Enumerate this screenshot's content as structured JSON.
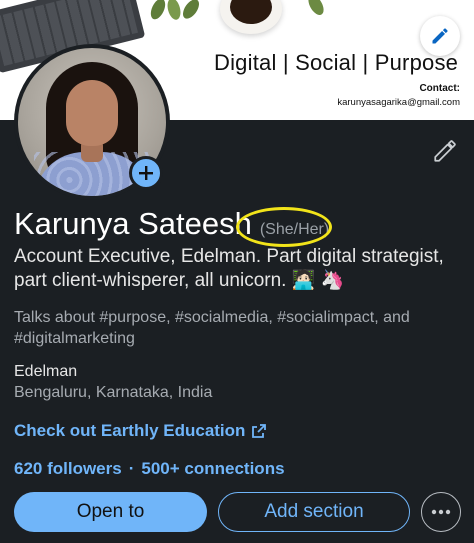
{
  "banner": {
    "tagline": "Digital | Social | Purpose",
    "contact_label": "Contact:",
    "contact_email": "karunyasagarika@gmail.com"
  },
  "profile": {
    "name": "Karunya Sateesh",
    "pronouns": "(She/Her)",
    "headline": "Account Executive, Edelman. Part digital strategist, part client-whisperer, all unicorn. 🧑🏻‍💻 🦄",
    "talks_about": "Talks about #purpose, #socialmedia, #socialimpact, and #digitalmarketing",
    "company": "Edelman",
    "location": "Bengaluru, Karnataka, India",
    "link_text": "Check out Earthly Education",
    "followers": "620 followers",
    "connections": "500+ connections"
  },
  "actions": {
    "primary": "Open to",
    "secondary": "Add section"
  },
  "colors": {
    "accent": "#70b5f9",
    "background": "#1b1f23",
    "highlight_circle": "#f2e41a"
  },
  "icons": {
    "banner_edit": "pencil-icon",
    "profile_edit": "pencil-icon",
    "add_photo": "plus-icon",
    "external_link": "external-link-icon",
    "more": "ellipsis-icon"
  }
}
